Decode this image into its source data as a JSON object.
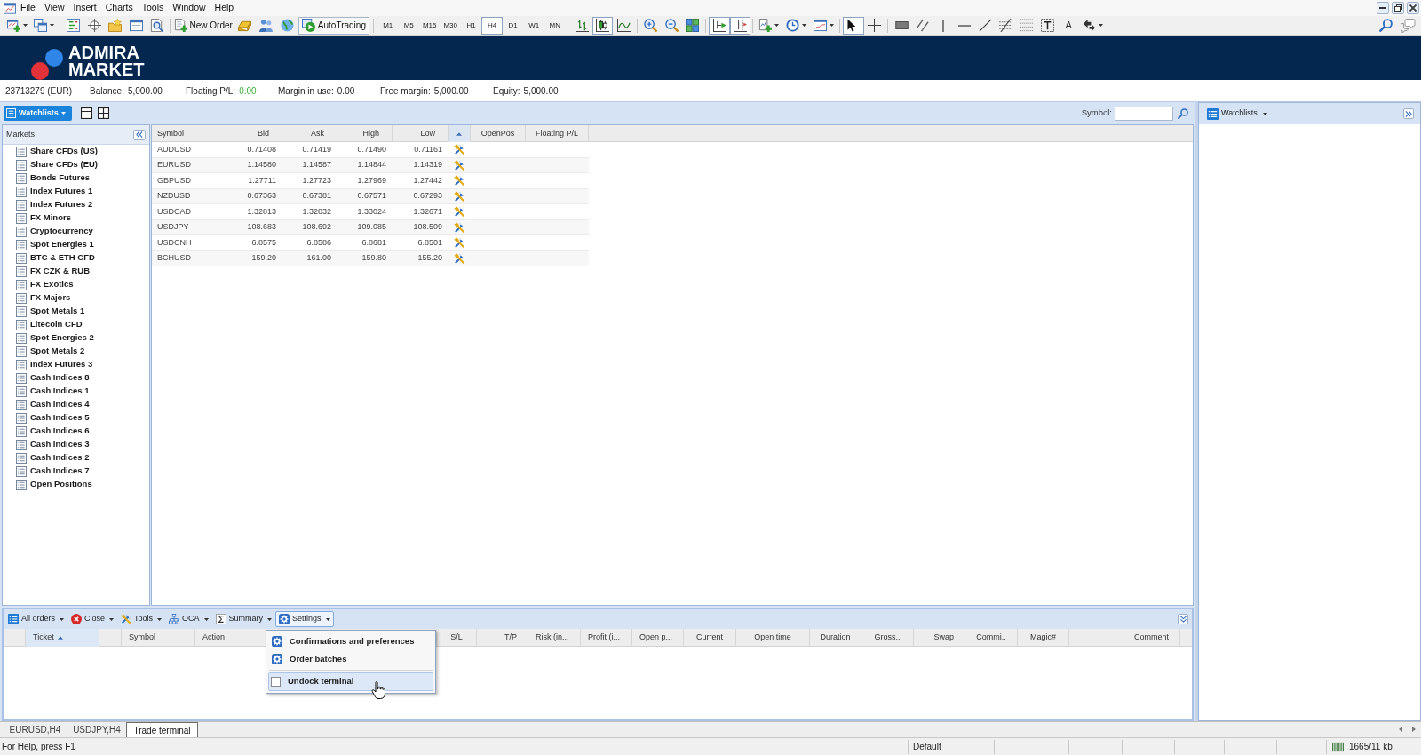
{
  "menu": [
    "File",
    "View",
    "Insert",
    "Charts",
    "Tools",
    "Window",
    "Help"
  ],
  "toolbar": {
    "new_order": "New Order",
    "autotrading": "AutoTrading",
    "timeframes": [
      {
        "label": "M1",
        "selected": false
      },
      {
        "label": "M5",
        "selected": false
      },
      {
        "label": "M15",
        "selected": false
      },
      {
        "label": "M30",
        "selected": false
      },
      {
        "label": "H1",
        "selected": false
      },
      {
        "label": "H4",
        "selected": true
      },
      {
        "label": "D1",
        "selected": false
      },
      {
        "label": "W1",
        "selected": false
      },
      {
        "label": "MN",
        "selected": false
      }
    ],
    "chart_modes": [
      {
        "selected": false
      },
      {
        "selected": true
      },
      {
        "selected": false
      }
    ],
    "chart_options": [
      {
        "on": true
      },
      {
        "on": true
      }
    ],
    "cursor_modes": [
      {
        "selected": true
      },
      {
        "selected": false
      }
    ],
    "text_tool": "A"
  },
  "banner": {
    "logo_lines": [
      "ADMIRA",
      "MARKET"
    ]
  },
  "account_bar": {
    "account": "23713279 (EUR)",
    "fields": [
      {
        "label": "Balance:",
        "value": "5,000.00",
        "kind": "amount"
      },
      {
        "label": "Floating P/L:",
        "value": "0.00",
        "kind": "pnl"
      },
      {
        "label": "Margin in use:",
        "value": "0.00",
        "kind": "amount"
      },
      {
        "label": "Free margin:",
        "value": "5,000.00",
        "kind": "amount"
      },
      {
        "label": "Equity:",
        "value": "5,000.00",
        "kind": "amount"
      }
    ]
  },
  "watchlists_bar": {
    "button": "Watchlists",
    "symbol_label": "Symbol:"
  },
  "markets": {
    "title": "Markets",
    "items": [
      {
        "label": "Share CFDs (US)",
        "selected": false
      },
      {
        "label": "Share CFDs (EU)",
        "selected": false
      },
      {
        "label": "Bonds Futures",
        "selected": false
      },
      {
        "label": "Index Futures 1",
        "selected": false
      },
      {
        "label": "Index Futures 2",
        "selected": false
      },
      {
        "label": "FX Minors",
        "selected": false
      },
      {
        "label": "Cryptocurrency",
        "selected": false
      },
      {
        "label": "Spot Energies 1",
        "selected": false
      },
      {
        "label": "BTC & ETH CFD",
        "selected": false
      },
      {
        "label": "FX CZK & RUB",
        "selected": false
      },
      {
        "label": "FX Exotics",
        "selected": false
      },
      {
        "label": "FX Majors",
        "selected": false
      },
      {
        "label": "Spot Metals 1",
        "selected": false
      },
      {
        "label": "Litecoin CFD",
        "selected": false
      },
      {
        "label": "Spot Energies 2",
        "selected": false
      },
      {
        "label": "Spot Metals 2",
        "selected": false
      },
      {
        "label": "Index Futures 3",
        "selected": false
      },
      {
        "label": "Cash Indices 8",
        "selected": false
      },
      {
        "label": "Cash Indices 1",
        "selected": false
      },
      {
        "label": "Cash Indices 4",
        "selected": false
      },
      {
        "label": "Cash Indices 5",
        "selected": false
      },
      {
        "label": "Cash Indices 6",
        "selected": false
      },
      {
        "label": "Cash Indices 3",
        "selected": false
      },
      {
        "label": "Cash Indices 2",
        "selected": false
      },
      {
        "label": "Cash Indices 7",
        "selected": false
      },
      {
        "label": "Open Positions",
        "selected": false
      }
    ]
  },
  "quotes_table": {
    "columns": [
      {
        "kind": "symbol",
        "label": "Symbol"
      },
      {
        "kind": "number",
        "label": "Bid"
      },
      {
        "kind": "number",
        "label": "Ask"
      },
      {
        "kind": "number",
        "label": "High"
      },
      {
        "kind": "number",
        "label": "Low"
      },
      {
        "kind": "tools"
      },
      {
        "kind": "info",
        "label": "OpenPos"
      },
      {
        "kind": "info",
        "label": "Floating P/L"
      }
    ],
    "rows": [
      {
        "cells": [
          "AUDUSD",
          "0.71408",
          "0.71419",
          "0.71490",
          "0.71161"
        ]
      },
      {
        "cells": [
          "EURUSD",
          "1.14580",
          "1.14587",
          "1.14844",
          "1.14319"
        ]
      },
      {
        "cells": [
          "GBPUSD",
          "1.27711",
          "1.27723",
          "1.27969",
          "1.27442"
        ]
      },
      {
        "cells": [
          "NZDUSD",
          "0.67363",
          "0.67381",
          "0.67571",
          "0.67293"
        ]
      },
      {
        "cells": [
          "USDCAD",
          "1.32813",
          "1.32832",
          "1.33024",
          "1.32671"
        ]
      },
      {
        "cells": [
          "USDJPY",
          "108.683",
          "108.692",
          "109.085",
          "108.509"
        ]
      },
      {
        "cells": [
          "USDCNH",
          "6.8575",
          "6.8586",
          "6.8681",
          "6.8501"
        ]
      },
      {
        "cells": [
          "BCHUSD",
          "159.20",
          "161.00",
          "159.80",
          "155.20"
        ]
      }
    ]
  },
  "right_panel": {
    "title": "Watchlists"
  },
  "terminal": {
    "toolbar": [
      {
        "label": "All orders",
        "expanded": false
      },
      {
        "label": "Close",
        "expanded": false
      },
      {
        "label": "Tools",
        "expanded": false
      },
      {
        "label": "OCA",
        "expanded": false
      },
      {
        "label": "Summary",
        "expanded": false
      },
      {
        "label": "Settings",
        "expanded": true
      }
    ],
    "columns": [
      {
        "label": "Ticket",
        "selected": true
      },
      {
        "label": "Symbol",
        "selected": false
      },
      {
        "label": "Action",
        "selected": false
      },
      {
        "label": "S/L",
        "selected": false
      },
      {
        "label": "T/P",
        "selected": false
      },
      {
        "label": "Risk (in...",
        "selected": false
      },
      {
        "label": "Profit (i...",
        "selected": false
      },
      {
        "label": "Open p...",
        "selected": false
      },
      {
        "label": "Current",
        "selected": false
      },
      {
        "label": "Open time",
        "selected": false
      },
      {
        "label": "Duration",
        "selected": false
      },
      {
        "label": "Gross..",
        "selected": false
      },
      {
        "label": "Swap",
        "selected": false
      },
      {
        "label": "Commi..",
        "selected": false
      },
      {
        "label": "Magic#",
        "selected": false
      },
      {
        "label": "Comment",
        "selected": false
      }
    ],
    "settings_menu": {
      "items": [
        {
          "kind": "command",
          "label": "Confirmations and preferences",
          "highlighted": false
        },
        {
          "kind": "command",
          "label": "Order batches",
          "highlighted": false
        },
        {
          "kind": "checkbox",
          "label": "Undock terminal",
          "checked": false,
          "highlighted": true
        }
      ]
    }
  },
  "tabs": [
    {
      "label": "EURUSD,H4",
      "selected": false
    },
    {
      "label": "USDJPY,H4",
      "selected": false
    },
    {
      "label": "Trade terminal",
      "selected": true
    }
  ],
  "status_bar": {
    "help": "For Help, press F1",
    "profile": "Default",
    "traffic": "1665/11 kb"
  }
}
